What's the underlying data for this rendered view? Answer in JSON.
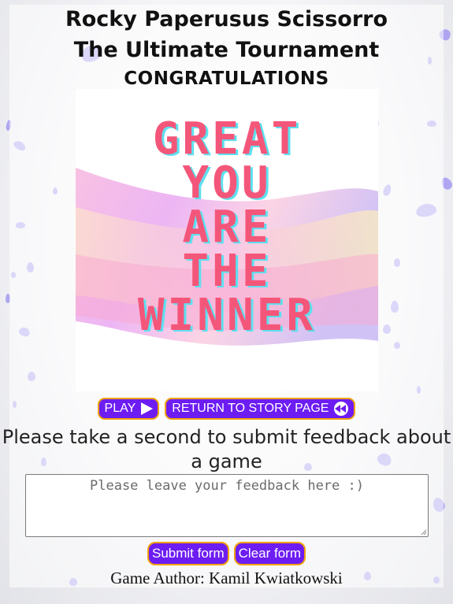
{
  "header": {
    "line1": "Rocky Paperusus Scissorro",
    "line2": "The Ultimate Tournament",
    "line3": "CONGRATULATIONS"
  },
  "poster": {
    "lines": [
      "GREAT",
      "YOU",
      "ARE",
      "THE",
      "WINNER"
    ],
    "text_color": "#f4567a",
    "shadow_color": "#5de0f0"
  },
  "nav": {
    "play_label": "PLAY",
    "play_icon": "play-triangle-icon",
    "story_label": "RETURN TO STORY PAGE",
    "story_icon": "rewind-icon"
  },
  "feedback": {
    "heading": "Please take a second to submit feedback about a game",
    "placeholder": "Please leave your feedback here :)",
    "value": "",
    "submit_label": "Submit form",
    "clear_label": "Clear form"
  },
  "footer": {
    "author": "Game Author: Kamil Kwiatkowski"
  },
  "colors": {
    "button_bg": "#6d1cf2",
    "button_border": "#f2a20c",
    "petal": "#9a8df0"
  }
}
